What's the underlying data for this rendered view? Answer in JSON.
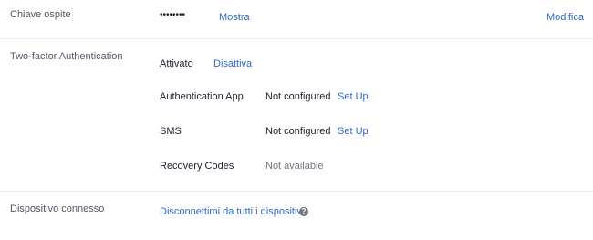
{
  "guest_key": {
    "label": "Chiave ospite",
    "masked_value": "••••••••",
    "show_link": "Mostra",
    "edit_link": "Modifica"
  },
  "two_factor": {
    "label": "Two-factor Authentication",
    "status": "Attivato",
    "disable_link": "Disattiva",
    "methods": [
      {
        "name": "Authentication App",
        "status": "Not configured",
        "action": "Set Up"
      },
      {
        "name": "SMS",
        "status": "Not configured",
        "action": "Set Up"
      },
      {
        "name": "Recovery Codes",
        "status": "Not available"
      }
    ]
  },
  "connected_device": {
    "label": "Dispositivo connesso",
    "disconnect_link": "Disconnettimi da tutti i dispositivi",
    "help_icon": "question-circle-icon",
    "help_glyph": "?"
  },
  "colors": {
    "link": "#2d6ac4",
    "label": "#555566",
    "divider": "#ececf0"
  }
}
